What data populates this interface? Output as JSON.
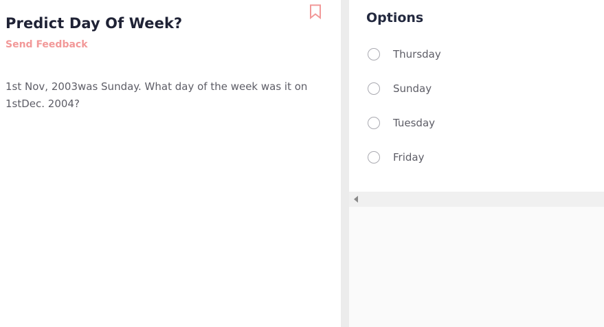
{
  "question": {
    "title": "Predict Day Of Week?",
    "feedback_label": "Send Feedback",
    "text": "1st Nov, 2003was Sunday. What day of the week was it on 1stDec. 2004?"
  },
  "options": {
    "heading": "Options",
    "items": [
      {
        "label": "Thursday",
        "selected": false
      },
      {
        "label": "Sunday",
        "selected": false
      },
      {
        "label": "Tuesday",
        "selected": false
      },
      {
        "label": "Friday",
        "selected": false
      }
    ]
  },
  "icons": {
    "bookmark": "bookmark-icon",
    "scroll_left": "scroll-left-arrow-icon",
    "radio": "radio-unchecked"
  },
  "colors": {
    "title": "#1f2235",
    "accent": "#f29898",
    "body_text": "#5d5d66",
    "radio_border": "#a9a9b0",
    "divider": "#ececec"
  }
}
